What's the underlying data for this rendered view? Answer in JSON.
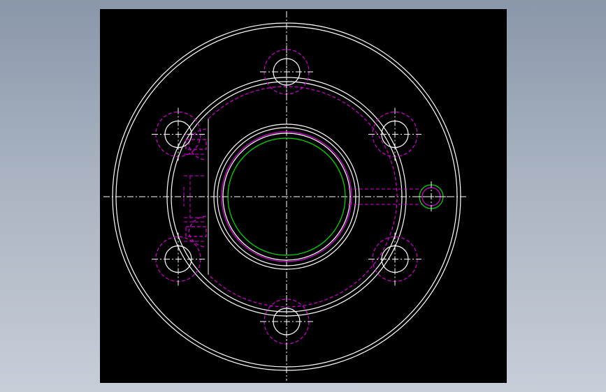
{
  "drawing": {
    "background_color": "#000000",
    "window_background_color": "#98a3b4",
    "layers": {
      "visible_edges": {
        "color": "#ffffff",
        "linetype": "continuous"
      },
      "hidden_edges": {
        "color": "#d400d4",
        "linetype": "dashed"
      },
      "center_lines": {
        "color": "#ffffff",
        "linetype": "dash-dot"
      },
      "bore": {
        "color": "#00dd00",
        "linetype": "continuous"
      }
    },
    "features": {
      "bolt_hole_count": 6,
      "radial_port_count": 1,
      "side_pocket_count": 2
    }
  }
}
